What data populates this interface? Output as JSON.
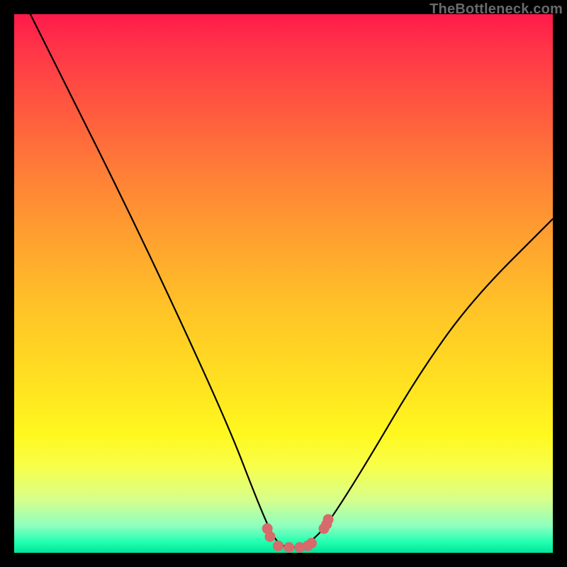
{
  "watermark": "TheBottleneck.com",
  "chart_data": {
    "type": "line",
    "title": "",
    "xlabel": "",
    "ylabel": "",
    "xlim": [
      0,
      100
    ],
    "ylim": [
      0,
      100
    ],
    "series": [
      {
        "name": "bottleneck-curve",
        "x": [
          3,
          10,
          20,
          30,
          40,
          45,
          48,
          50,
          53,
          55,
          58,
          65,
          75,
          85,
          100
        ],
        "y": [
          100,
          86,
          66,
          45,
          23,
          10,
          3,
          1,
          1,
          2,
          5,
          16,
          33,
          47,
          62
        ],
        "color": "#000000"
      }
    ],
    "markers": {
      "color": "#d76a6a",
      "points": [
        {
          "x": 47,
          "y": 4.5
        },
        {
          "x": 47.5,
          "y": 3
        },
        {
          "x": 49,
          "y": 1.3
        },
        {
          "x": 51,
          "y": 1.0
        },
        {
          "x": 53,
          "y": 1.0
        },
        {
          "x": 54.5,
          "y": 1.3
        },
        {
          "x": 55.2,
          "y": 1.8
        },
        {
          "x": 57.5,
          "y": 4.5
        },
        {
          "x": 58,
          "y": 5.3
        },
        {
          "x": 58.3,
          "y": 6.2
        }
      ]
    }
  }
}
